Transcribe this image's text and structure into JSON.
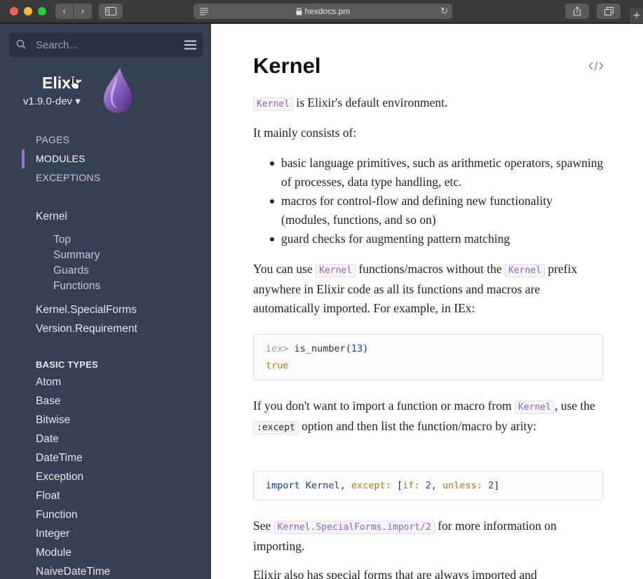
{
  "browser": {
    "url": "hexdocs.pm",
    "back_icon": "‹",
    "forward_icon": "›",
    "reload_icon": "↻",
    "new_tab_icon": "+"
  },
  "sidebar": {
    "search_placeholder": "Search...",
    "project_name": "Elixir",
    "version": "v1.9.0-dev ▾",
    "tabs": [
      {
        "label": "PAGES",
        "active": false
      },
      {
        "label": "MODULES",
        "active": true
      },
      {
        "label": "EXCEPTIONS",
        "active": false
      }
    ],
    "current_module": "Kernel",
    "current_sections": [
      "Top",
      "Summary",
      "Guards",
      "Functions"
    ],
    "modules_after": [
      "Kernel.SpecialForms",
      "Version.Requirement"
    ],
    "group_heading": "BASIC TYPES",
    "group_items": [
      "Atom",
      "Base",
      "Bitwise",
      "Date",
      "DateTime",
      "Exception",
      "Float",
      "Function",
      "Integer",
      "Module",
      "NaiveDateTime"
    ]
  },
  "content": {
    "title": "Kernel",
    "p1_code": "Kernel",
    "p1_text": " is Elixir's default environment.",
    "p2": "It mainly consists of:",
    "bullets": [
      "basic language primitives, such as arithmetic operators, spawning of processes, data type handling, etc.",
      "macros for control-flow and defining new functionality (modules, functions, and so on)",
      "guard checks for augmenting pattern matching"
    ],
    "p3_a": "You can use ",
    "p3_code1": "Kernel",
    "p3_b": " functions/macros without the ",
    "p3_code2": "Kernel",
    "p3_c": " prefix anywhere in Elixir code as all its functions and macros are automatically imported. For example, in IEx:",
    "code1": {
      "prompt": "iex> ",
      "call": "is_number(",
      "arg": "13",
      "close": ")",
      "result": "true"
    },
    "p4_a": "If you don't want to import a function or macro from ",
    "p4_code1": "Kernel",
    "p4_b": ", use the ",
    "p4_code2": ":except",
    "p4_c": " option and then list the function/macro by arity:",
    "code2": {
      "kw": "import",
      "mod": " Kernel",
      "comma": ", ",
      "key1": "except:",
      "open": " [",
      "key2": "if:",
      "num1": " 2",
      "sep": ", ",
      "key3": "unless:",
      "num2": " 2",
      "close": "]"
    },
    "p5_a": "See ",
    "p5_code": "Kernel.SpecialForms.import/2",
    "p5_b": " for more information on importing.",
    "p6": "Elixir also has special forms that are always imported and"
  },
  "colors": {
    "sidebar_bg": "#373f52",
    "accent": "#9a6fd4",
    "code_purple": "#8e5fc4"
  }
}
